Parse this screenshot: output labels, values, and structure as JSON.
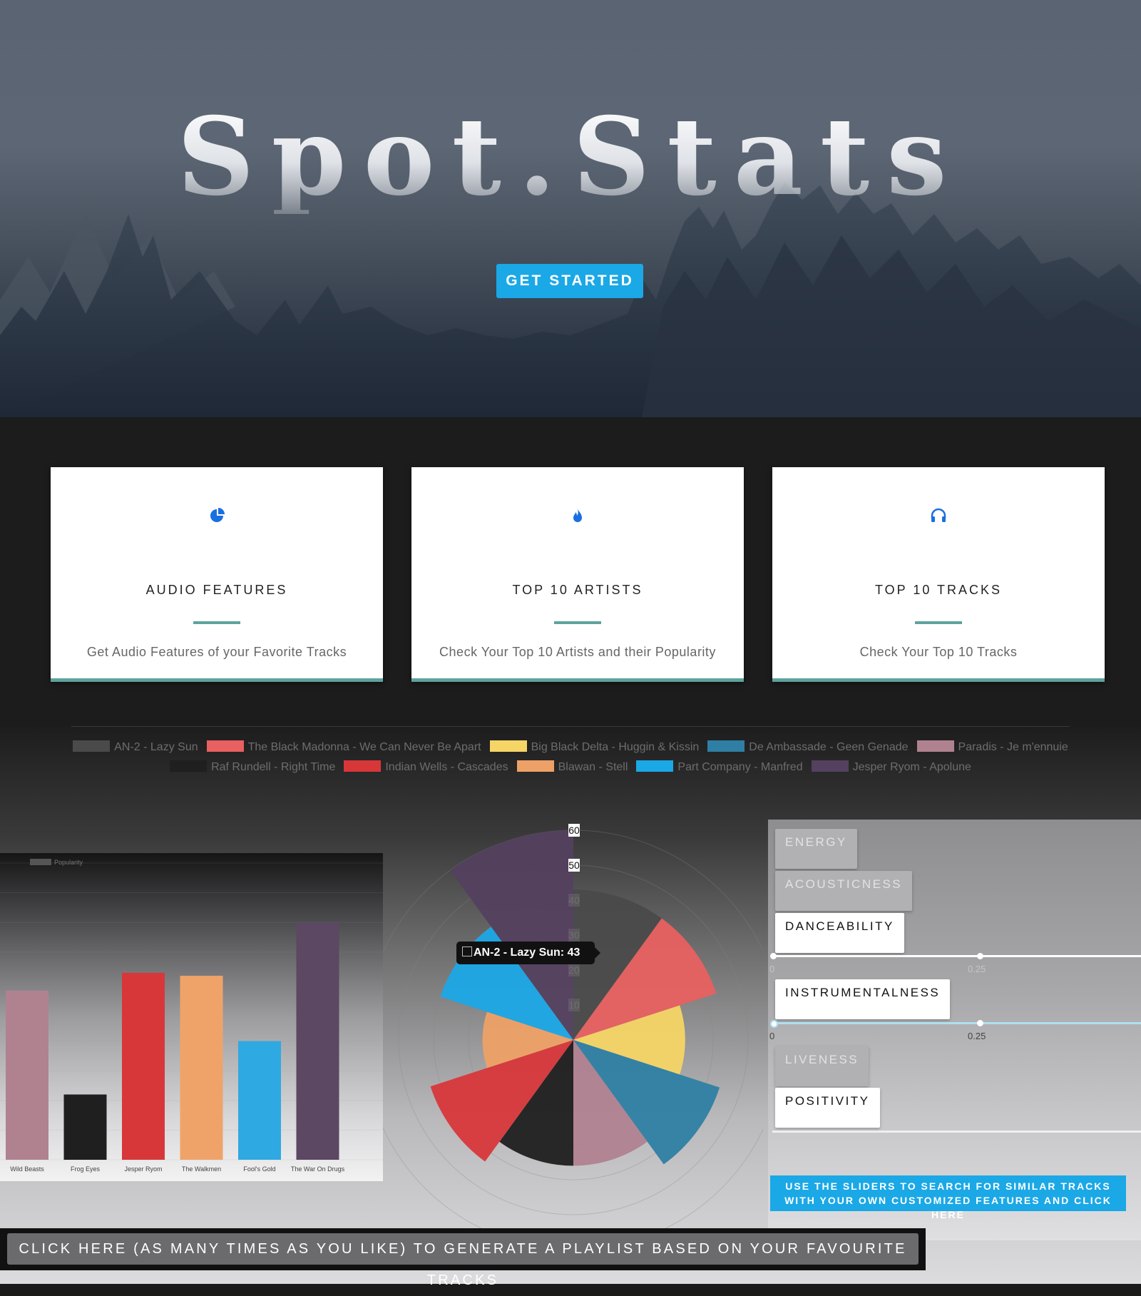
{
  "hero": {
    "title": "Spot.Stats",
    "cta_label": "GET STARTED"
  },
  "features": [
    {
      "icon": "pie-chart-icon",
      "title": "AUDIO FEATURES",
      "text": "Get Audio Features of your Favorite Tracks"
    },
    {
      "icon": "fire-icon",
      "title": "TOP 10 ARTISTS",
      "text": "Check Your Top 10 Artists and their Popularity"
    },
    {
      "icon": "headphones-icon",
      "title": "TOP 10 TRACKS",
      "text": "Check Your Top 10 Tracks"
    }
  ],
  "colors": {
    "accent": "#1ba8e6",
    "teal": "#5fa39d"
  },
  "bar_chart": {
    "legend": "Popularity"
  },
  "chart_data": [
    {
      "type": "bar",
      "legend": [
        "Popularity"
      ],
      "categories": [
        "Wild Beasts",
        "Frog Eyes",
        "Jesper Ryom",
        "The Walkmen",
        "Fool's Gold",
        "The War On Drugs"
      ],
      "series": [
        {
          "name": "Popularity",
          "values": [
            57,
            22,
            63,
            62,
            40,
            80
          ],
          "colors": [
            "#b08290",
            "#1f1f1f",
            "#d8373a",
            "#f0a369",
            "#2fa9e2",
            "#5c4862"
          ]
        }
      ]
    },
    {
      "type": "polar",
      "r_ticks": [
        10,
        20,
        30,
        40,
        50,
        60
      ],
      "r_max": 60,
      "labels": [
        "AN-2 - Lazy Sun",
        "The Black Madonna - We Can Never Be Apart",
        "Big Black Delta - Huggin & Kissin",
        "De Ambassade - Geen Genade",
        "Paradis - Je m'ennuie",
        "Raf Rundell - Right Time",
        "Indian Wells - Cascades",
        "Blawan - Stell",
        "Part Company - Manfred",
        "Jesper Ryom - Apolune"
      ],
      "values": [
        43,
        43,
        32,
        44,
        36,
        36,
        43,
        26,
        40,
        60
      ],
      "colors": [
        "#4a4a4a",
        "#e86060",
        "#f4d566",
        "#2e7fa3",
        "#b08290",
        "#1f1f1f",
        "#d8373a",
        "#eea166",
        "#1ba8e6",
        "#54405f"
      ],
      "tooltip": "AN-2 - Lazy Sun: 43"
    }
  ],
  "sliders": {
    "buttons": [
      {
        "label": "ENERGY",
        "active": false
      },
      {
        "label": "ACOUSTICNESS",
        "active": false
      },
      {
        "label": "DANCEABILITY",
        "active": true
      },
      {
        "label": "INSTRUMENTALNESS",
        "active": true
      },
      {
        "label": "LIVENESS",
        "active": false
      },
      {
        "label": "POSITIVITY",
        "active": true
      }
    ],
    "tick_zero": "0",
    "tick_quarter": "0.25",
    "hint": "USE THE SLIDERS TO SEARCH FOR SIMILAR TRACKS WITH YOUR OWN CUSTOMIZED FEATURES AND CLICK HERE"
  },
  "generate_label": "CLICK HERE (AS MANY TIMES AS YOU LIKE) TO GENERATE A PLAYLIST BASED ON YOUR FAVOURITE TRACKS"
}
